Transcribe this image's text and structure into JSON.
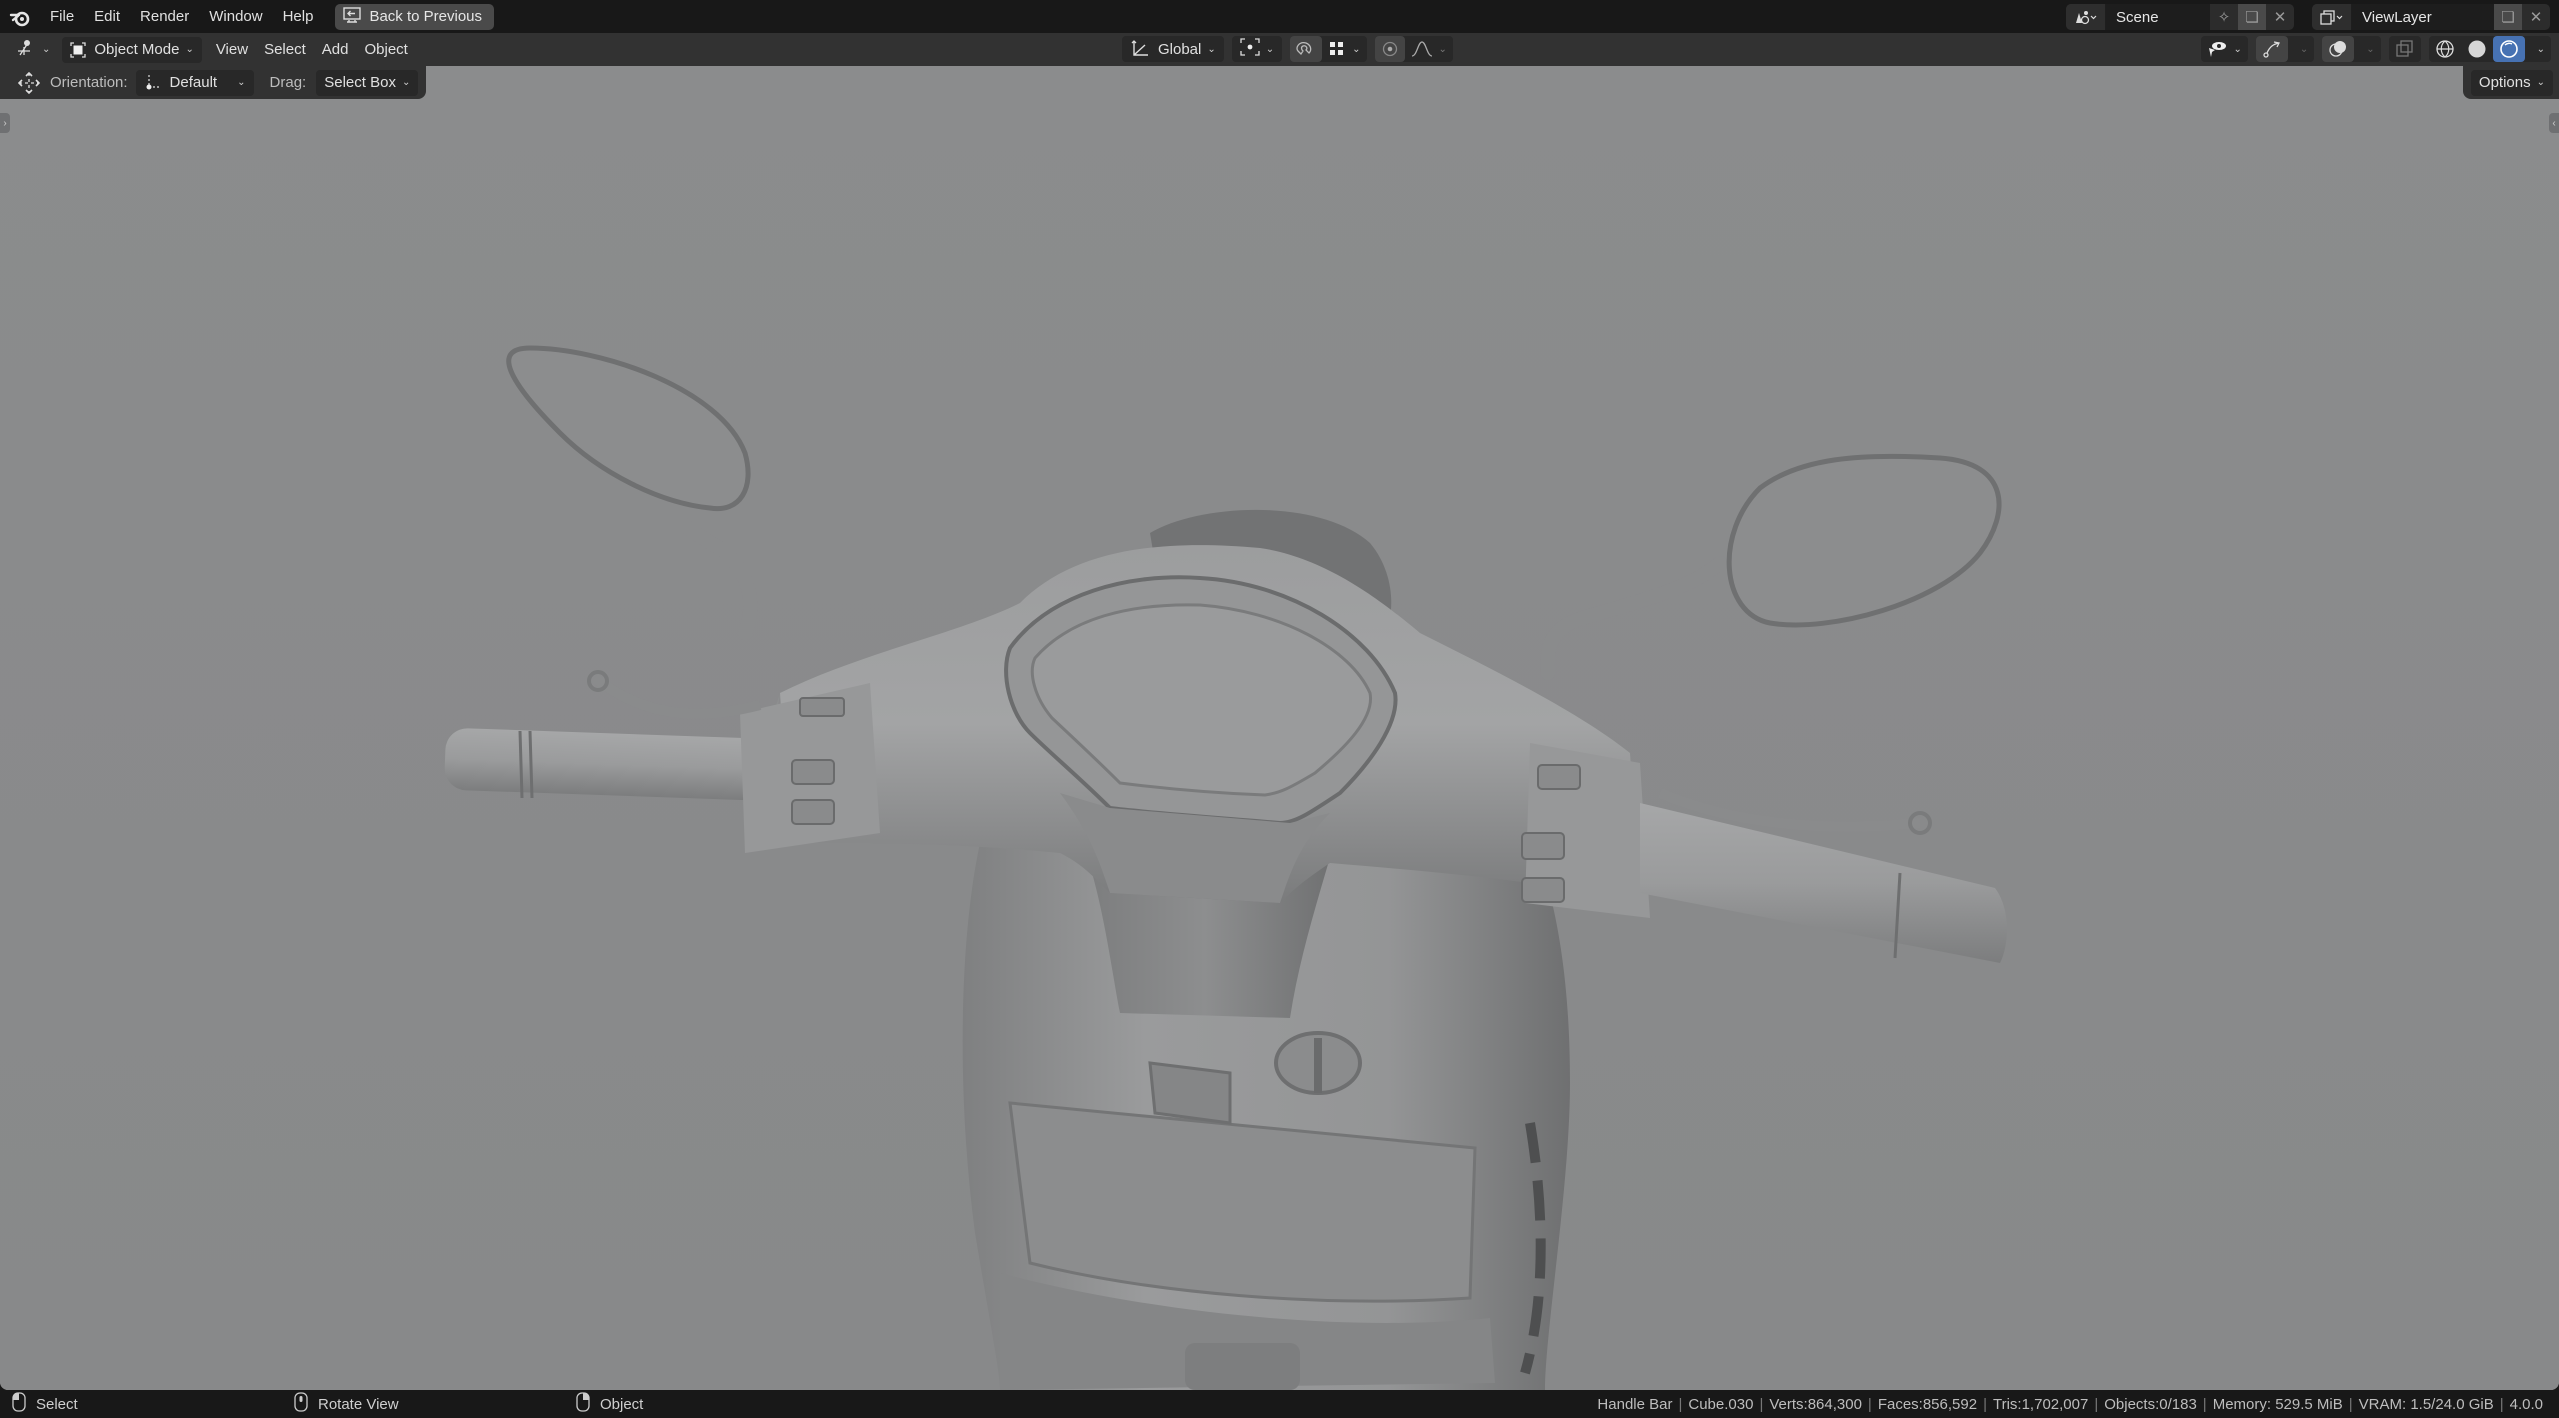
{
  "topbar": {
    "menu": [
      "File",
      "Edit",
      "Render",
      "Window",
      "Help"
    ],
    "back_button": "Back to Previous",
    "scene": {
      "icon": "scene-icon",
      "name": "Scene"
    },
    "view_layer": {
      "icon": "view-layer-icon",
      "name": "ViewLayer"
    }
  },
  "viewport_header": {
    "editor_type_icon": "viewport-3d-icon",
    "mode": "Object Mode",
    "menus": [
      "View",
      "Select",
      "Add",
      "Object"
    ],
    "transform_orientation": "Global",
    "pivot_icon": "pivot-point-icon",
    "snap_icon": "snap-magnet-icon",
    "snap_target_icon": "snap-increment-icon",
    "proportional_icon": "proportional-edit-icon",
    "falloff_icon": "falloff-curve-icon",
    "right_icons": [
      "selectability-visibility-icon",
      "gizmo-icon",
      "overlays-icon",
      "xray-icon"
    ],
    "shading_modes": [
      "wireframe",
      "solid",
      "material-preview"
    ],
    "active_shading": "material-preview",
    "accent_color": "#4772b3"
  },
  "tool_header": {
    "tool_icon": "move-tool-icon",
    "orientation_label": "Orientation:",
    "orientation_value": "Default",
    "drag_label": "Drag:",
    "drag_value": "Select Box",
    "options_label": "Options"
  },
  "statusbar": {
    "hints": [
      {
        "icon": "mouse-left-icon",
        "label": "Select"
      },
      {
        "icon": "mouse-middle-icon",
        "label": "Rotate View"
      },
      {
        "icon": "mouse-right-icon",
        "label": "Object"
      }
    ],
    "stats": [
      "Handle Bar",
      "Cube.030",
      "Verts:864,300",
      "Faces:856,592",
      "Tris:1,702,007",
      "Objects:0/183",
      "Memory: 529.5 MiB",
      "VRAM: 1.5/24.0 GiB",
      "4.0.0"
    ]
  },
  "viewport": {
    "subject": "Scooter handlebar 3D model (solid grey clay render)",
    "background_color": "#8a8b8c"
  }
}
